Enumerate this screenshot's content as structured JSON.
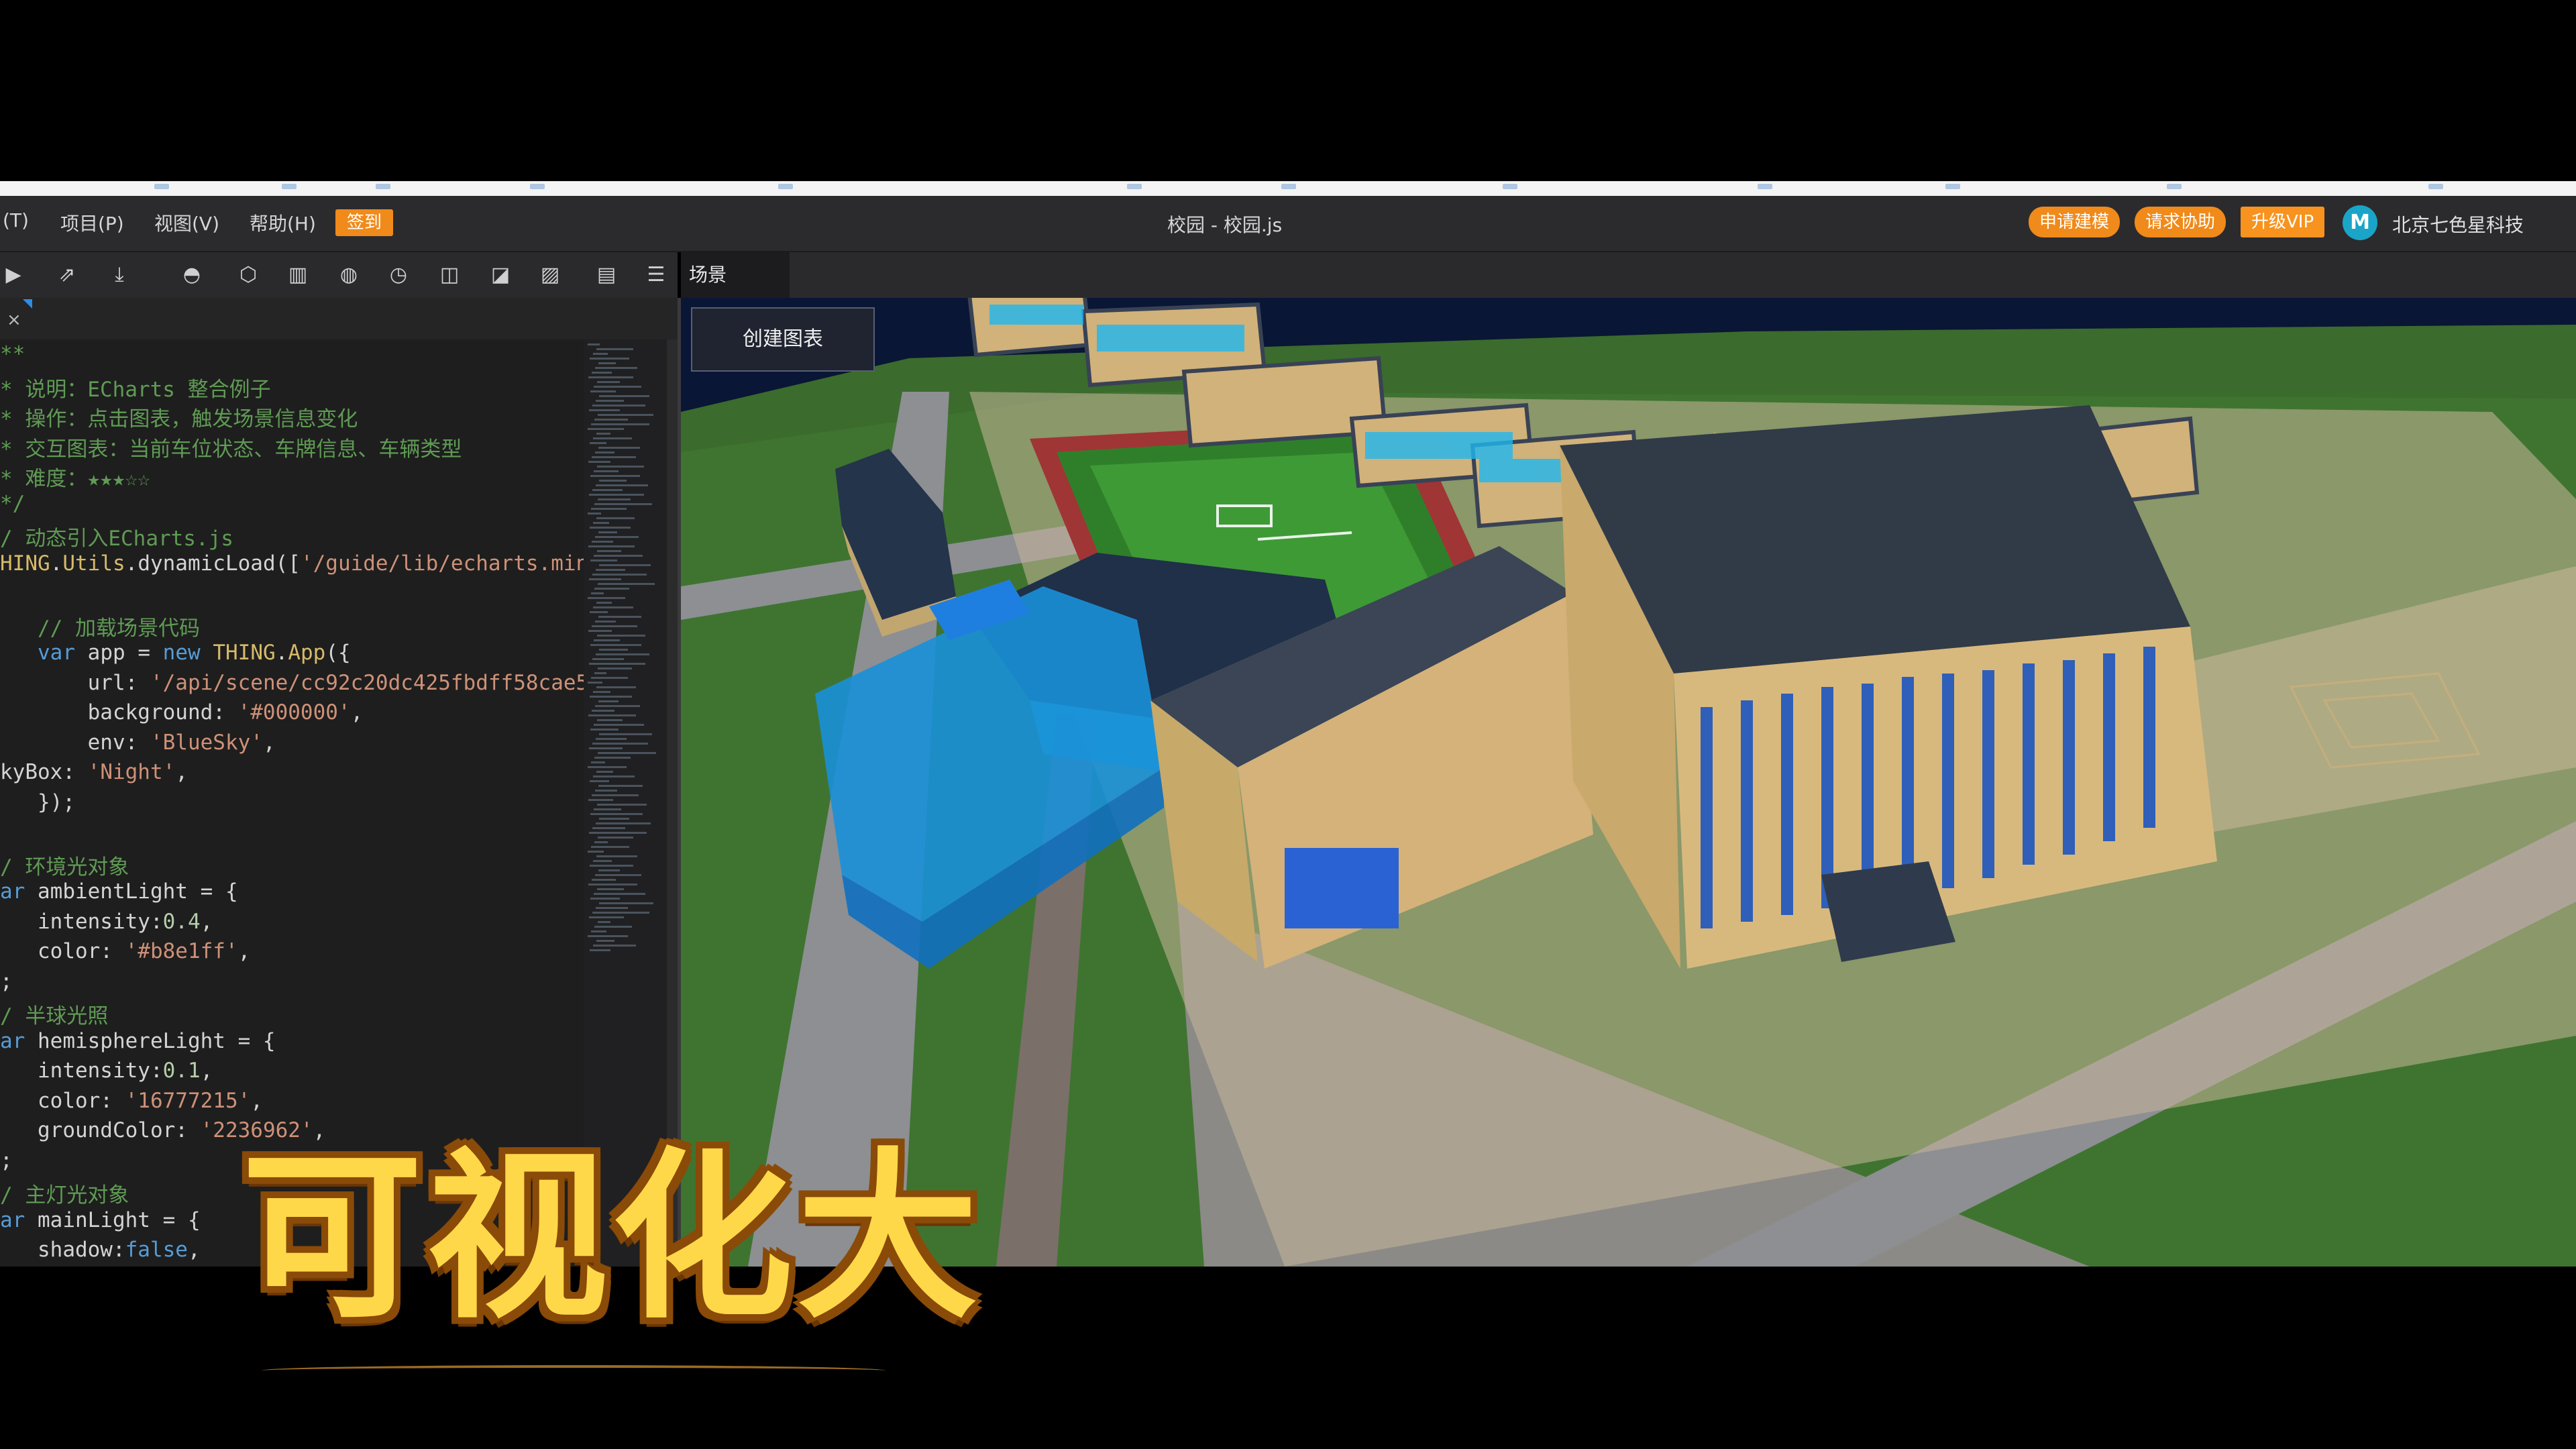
{
  "menu": {
    "items": [
      "(T)",
      "项目(P)",
      "视图(V)",
      "帮助(H)"
    ],
    "sign_label": "签到"
  },
  "window_title": "校园 - 校园.js",
  "actions": {
    "apply_model": "申请建模",
    "request_help": "请求协助",
    "upgrade_vip": "升级VIP"
  },
  "brand": {
    "logo_glyph": "M",
    "company": "北京七色星科技"
  },
  "tools": [
    {
      "name": "run-icon",
      "glyph": "▶"
    },
    {
      "name": "share-icon",
      "glyph": "⇗"
    },
    {
      "name": "download-icon",
      "glyph": "⤓"
    },
    {
      "name": "hemisphere-icon",
      "glyph": "◓"
    },
    {
      "name": "cube-icon",
      "glyph": "⬡"
    },
    {
      "name": "book-icon",
      "glyph": "▥"
    },
    {
      "name": "globe-icon",
      "glyph": "◍"
    },
    {
      "name": "clock-icon",
      "glyph": "◷"
    },
    {
      "name": "layout-icon",
      "glyph": "◫"
    },
    {
      "name": "image-icon",
      "glyph": "◪"
    },
    {
      "name": "picture-icon",
      "glyph": "▨"
    },
    {
      "name": "document-icon",
      "glyph": "▤"
    },
    {
      "name": "settings-list-icon",
      "glyph": "☰"
    }
  ],
  "scene_tab": "场景",
  "editor": {
    "close_glyph": "×",
    "lines": [
      [
        [
          "c",
          "**"
        ]
      ],
      [
        [
          "c",
          "* 说明：ECharts 整合例子"
        ]
      ],
      [
        [
          "c",
          "* 操作：点击图表，触发场景信息变化"
        ]
      ],
      [
        [
          "c",
          "* 交互图表：当前车位状态、车牌信息、车辆类型"
        ]
      ],
      [
        [
          "c",
          "* 难度：★★★☆☆"
        ]
      ],
      [
        [
          "c",
          "*/"
        ]
      ],
      [
        [
          "c",
          "/ 动态引入ECharts.js"
        ]
      ],
      [
        [
          "f",
          "HING"
        ],
        [
          "t",
          "."
        ],
        [
          "f",
          "Utils"
        ],
        [
          "t",
          ".dynamicLoad(["
        ],
        [
          "s",
          "'/guide/lib/echarts.min"
        ]
      ],
      [
        [
          "t",
          ""
        ]
      ],
      [
        [
          "t",
          "   "
        ],
        [
          "c",
          "// 加载场景代码"
        ]
      ],
      [
        [
          "t",
          "   "
        ],
        [
          "k",
          "var"
        ],
        [
          "t",
          " app = "
        ],
        [
          "k",
          "new"
        ],
        [
          "t",
          " "
        ],
        [
          "f",
          "THING"
        ],
        [
          "t",
          "."
        ],
        [
          "f",
          "App"
        ],
        [
          "t",
          "({"
        ]
      ],
      [
        [
          "t",
          "       url: "
        ],
        [
          "s",
          "'/api/scene/cc92c20dc425fbdff58cae5"
        ]
      ],
      [
        [
          "t",
          "       background: "
        ],
        [
          "s",
          "'#000000'"
        ],
        [
          "t",
          ","
        ]
      ],
      [
        [
          "t",
          "       env: "
        ],
        [
          "s",
          "'BlueSky'"
        ],
        [
          "t",
          ","
        ]
      ],
      [
        [
          "t",
          "kyBox: "
        ],
        [
          "s",
          "'Night'"
        ],
        [
          "t",
          ","
        ]
      ],
      [
        [
          "t",
          "   });"
        ]
      ],
      [
        [
          "t",
          ""
        ]
      ],
      [
        [
          "c",
          "/ 环境光对象"
        ]
      ],
      [
        [
          "k",
          "ar"
        ],
        [
          "t",
          " ambientLight = {"
        ]
      ],
      [
        [
          "t",
          "   intensity:"
        ],
        [
          "n",
          "0.4"
        ],
        [
          "t",
          ","
        ]
      ],
      [
        [
          "t",
          "   color: "
        ],
        [
          "s",
          "'#b8e1ff'"
        ],
        [
          "t",
          ","
        ]
      ],
      [
        [
          "t",
          ";"
        ]
      ],
      [
        [
          "c",
          "/ 半球光照"
        ]
      ],
      [
        [
          "k",
          "ar"
        ],
        [
          "t",
          " hemisphereLight = {"
        ]
      ],
      [
        [
          "t",
          "   intensity:"
        ],
        [
          "n",
          "0.1"
        ],
        [
          "t",
          ","
        ]
      ],
      [
        [
          "t",
          "   color: "
        ],
        [
          "s",
          "'16777215'"
        ],
        [
          "t",
          ","
        ]
      ],
      [
        [
          "t",
          "   groundColor: "
        ],
        [
          "s",
          "'2236962'"
        ],
        [
          "t",
          ","
        ]
      ],
      [
        [
          "t",
          ";"
        ]
      ],
      [
        [
          "c",
          "/ 主灯光对象"
        ]
      ],
      [
        [
          "k",
          "ar"
        ],
        [
          "t",
          " mainLight = {"
        ]
      ],
      [
        [
          "t",
          "   shadow:"
        ],
        [
          "k",
          "false"
        ],
        [
          "t",
          ","
        ]
      ]
    ]
  },
  "create_chart_label": "创建图表",
  "caption": "可视化大"
}
